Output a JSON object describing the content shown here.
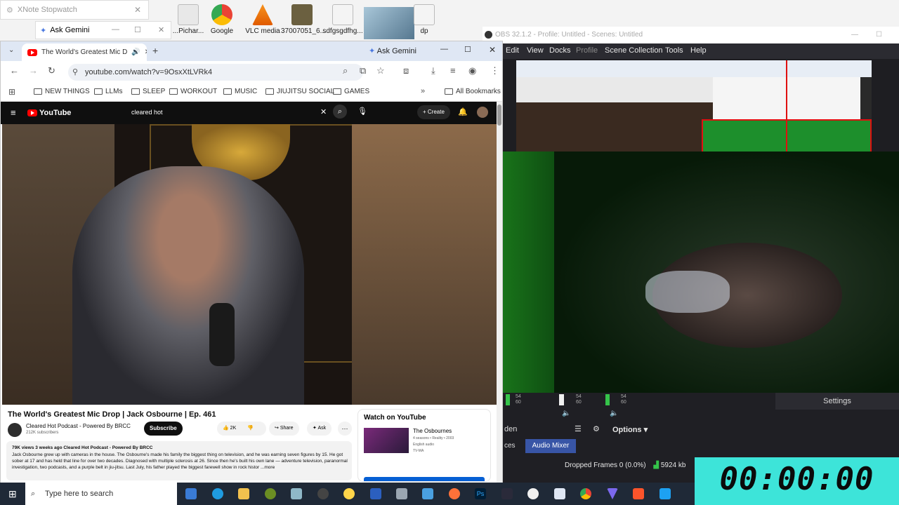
{
  "desktop": {
    "xnote_title": "XNote Stopwatch",
    "gemini_label": "Ask Gemini",
    "icons": [
      {
        "label": "...Pichar...",
        "icon": "document-icon"
      },
      {
        "label": "Google",
        "icon": "chrome-icon"
      },
      {
        "label": "VLC media",
        "icon": "vlc-icon"
      },
      {
        "label": "37007051_6...",
        "icon": "image-file-icon"
      },
      {
        "label": "sdfgsgdfhg...",
        "icon": "document-icon"
      },
      {
        "label": "dp",
        "icon": "document-icon"
      }
    ]
  },
  "browser": {
    "tab_title": "The World's Greatest Mic D",
    "gemini_button": "Ask Gemini",
    "url": "youtube.com/watch?v=9OsxXtLVRk4",
    "bookmarks": [
      "NEW THINGS",
      "LLMs",
      "SLEEP",
      "WORKOUT",
      "MUSIC",
      "JIUJITSU SOCIAL",
      "GAMES"
    ],
    "all_bookmarks": "All Bookmarks"
  },
  "youtube": {
    "logo": "YouTube",
    "search_value": "cleared hot",
    "create_label": "Create",
    "video_title": "The World's Greatest Mic Drop | Jack Osbourne | Ep. 461",
    "channel_name": "Cleared Hot Podcast - Powered By BRCC",
    "subscribers": "212K subscribers",
    "subscribe_label": "Subscribe",
    "likes": "2K",
    "share_label": "Share",
    "ask_label": "Ask",
    "stats_line": "79K views  3 weeks ago  Cleared Hot Podcast - Powered By BRCC",
    "description": "Jack Osbourne grew up with cameras in the house. The Osbourne's made his family the biggest thing on television, and he was earning seven figures by 15. He got sober at 17 and has held that line for over two decades. Diagnosed with multiple sclerosis at 26. Since then he's built his own lane — adventure television, paranormal investigation, two podcasts, and a purple belt in jiu-jitsu. Last July, his father played the biggest farewell show in rock histor ...more",
    "watch_on_label": "Watch on YouTube",
    "rec_title": "The Osbournes",
    "rec_meta": "4 seasons • Reality • 2003",
    "rec_lang": "English audio",
    "rec_rating": "TV-MA"
  },
  "obs": {
    "title": "OBS 32.1.2 - Profile: Untitled - Scenes: Untitled",
    "menu": [
      "Edit",
      "View",
      "Docks",
      "Profile",
      "Scene Collection",
      "Tools",
      "Help"
    ],
    "settings_label": "Settings",
    "options_label": "Options",
    "hidden_label": "den",
    "sources_label": "ces",
    "audio_mixer_label": "Audio Mixer",
    "dropped_frames": "Dropped Frames 0 (0.0%)",
    "bitrate": "5924 kb",
    "meter_labels": [
      "54",
      "60",
      "54",
      "60",
      "54",
      "60"
    ]
  },
  "stopwatch": {
    "time": "00:00:00"
  },
  "taskbar": {
    "search_placeholder": "Type here to search"
  }
}
